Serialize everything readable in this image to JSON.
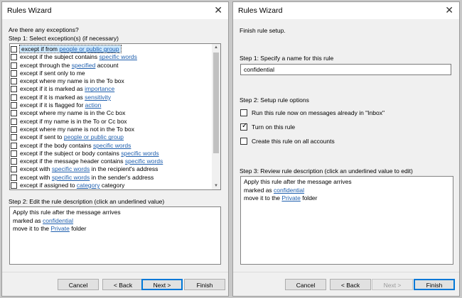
{
  "left": {
    "title": "Rules Wizard",
    "question": "Are there any exceptions?",
    "step1": "Step 1: Select exception(s) (if necessary)",
    "exceptions": [
      {
        "pre": "except if from ",
        "link": "people or public group",
        "post": ""
      },
      {
        "pre": "except if the subject contains ",
        "link": "specific words",
        "post": ""
      },
      {
        "pre": "except through the ",
        "link": "specified",
        "post": " account"
      },
      {
        "pre": "except if sent only to me",
        "link": "",
        "post": ""
      },
      {
        "pre": "except where my name is in the To box",
        "link": "",
        "post": ""
      },
      {
        "pre": "except if it is marked as ",
        "link": "importance",
        "post": ""
      },
      {
        "pre": "except if it is marked as ",
        "link": "sensitivity",
        "post": ""
      },
      {
        "pre": "except if it is flagged for ",
        "link": "action",
        "post": ""
      },
      {
        "pre": "except where my name is in the Cc box",
        "link": "",
        "post": ""
      },
      {
        "pre": "except if my name is in the To or Cc box",
        "link": "",
        "post": ""
      },
      {
        "pre": "except where my name is not in the To box",
        "link": "",
        "post": ""
      },
      {
        "pre": "except if sent to ",
        "link": "people or public group",
        "post": ""
      },
      {
        "pre": "except if the body contains ",
        "link": "specific words",
        "post": ""
      },
      {
        "pre": "except if the subject or body contains ",
        "link": "specific words",
        "post": ""
      },
      {
        "pre": "except if the message header contains ",
        "link": "specific words",
        "post": ""
      },
      {
        "pre": "except with ",
        "link": "specific words",
        "post": " in the recipient's address"
      },
      {
        "pre": "except with ",
        "link": "specific words",
        "post": " in the sender's address"
      },
      {
        "pre": "except if assigned to ",
        "link": "category",
        "post": " category"
      }
    ],
    "step2": "Step 2: Edit the rule description (click an underlined value)",
    "desc_line1": "Apply this rule after the message arrives",
    "desc_line2_pre": "marked as ",
    "desc_line2_link": "confidential",
    "desc_line3_pre": "move it to the ",
    "desc_line3_link": "Private",
    "desc_line3_post": " folder",
    "buttons": {
      "cancel": "Cancel",
      "back": "< Back",
      "next": "Next >",
      "finish": "Finish"
    }
  },
  "right": {
    "title": "Rules Wizard",
    "heading": "Finish rule setup.",
    "step1": "Step 1: Specify a name for this rule",
    "name_value": "confidential",
    "step2": "Step 2: Setup rule options",
    "opt_run_now": "Run this rule now on messages already in \"Inbox\"",
    "opt_turn_on": "Turn on this rule",
    "opt_all_accounts": "Create this rule on all accounts",
    "opt_checked": [
      false,
      true,
      false
    ],
    "step3": "Step 3: Review rule description (click an underlined value to edit)",
    "desc_line1": "Apply this rule after the message arrives",
    "desc_line2_pre": "marked as ",
    "desc_line2_link": "confidential",
    "desc_line3_pre": "move it to the ",
    "desc_line3_link": "Private",
    "desc_line3_post": " folder",
    "buttons": {
      "cancel": "Cancel",
      "back": "< Back",
      "next": "Next >",
      "finish": "Finish"
    }
  },
  "close_glyph": "✕",
  "check_glyph": "✓",
  "colors": {
    "link": "#1f5fae",
    "selection": "#cde8ff",
    "accent": "#0078d7"
  }
}
